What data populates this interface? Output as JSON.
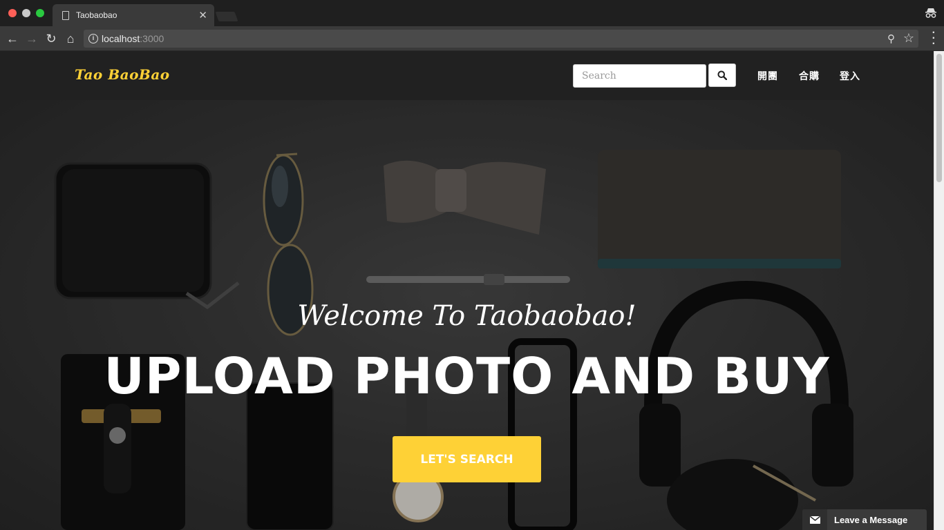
{
  "browser": {
    "tab_title": "Taobaobao",
    "url_host": "localhost",
    "url_port": ":3000"
  },
  "navbar": {
    "brand": "Tao BaoBao",
    "search_placeholder": "Search",
    "links": [
      "開團",
      "合購",
      "登入"
    ]
  },
  "hero": {
    "welcome": "Welcome To Taobaobao!",
    "heading": "UPLOAD PHOTO AND BUY",
    "cta_label": "Let's Search"
  },
  "widget": {
    "label": "Leave a Message"
  },
  "colors": {
    "accent": "#fed136",
    "navbar_bg": "#212121"
  }
}
